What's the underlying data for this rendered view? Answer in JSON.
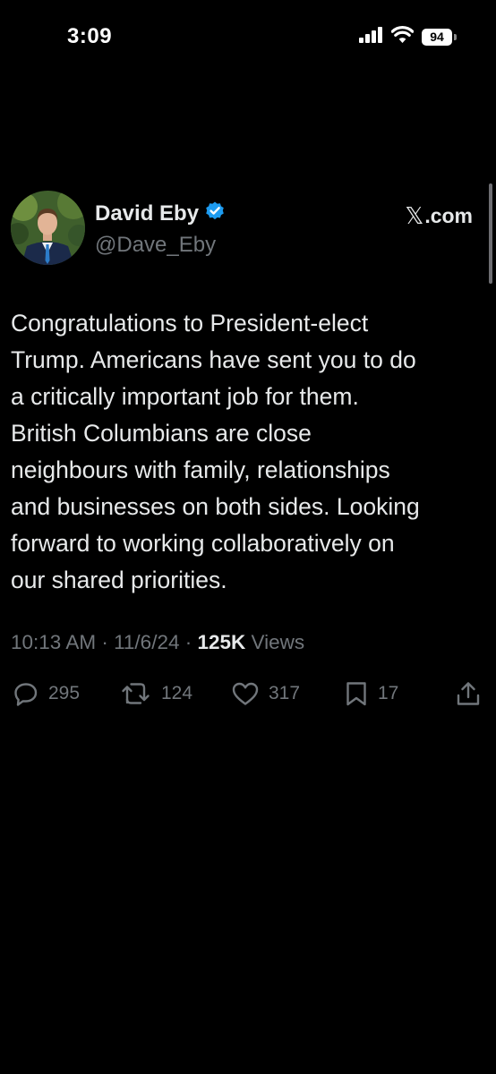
{
  "status_bar": {
    "time": "3:09",
    "battery_level": "94",
    "icons": [
      "cellular-signal-icon",
      "wifi-icon",
      "battery-icon"
    ]
  },
  "tweet": {
    "author": {
      "display_name": "David Eby",
      "handle": "@Dave_Eby",
      "verified": true
    },
    "source": {
      "glyph": "𝕏",
      "label": ".com"
    },
    "text_lines": [
      "Congratulations to President-elect",
      "Trump. Americans have sent you to do",
      "a critically important job for them.",
      "British Columbians are close",
      "neighbours with family, relationships",
      "and businesses on both sides. Looking",
      "forward to working collaboratively on",
      "our shared priorities."
    ],
    "meta": {
      "time": "10:13 AM",
      "sep1": " · ",
      "date": "11/6/24",
      "sep2": " · ",
      "views_count": "125K",
      "views_label": " Views"
    },
    "actions": {
      "replies": "295",
      "reposts": "124",
      "likes": "317",
      "bookmarks": "17"
    }
  },
  "colors": {
    "background": "#000000",
    "primary_text": "#e7e9ea",
    "secondary_text": "#71767b",
    "verified_badge": "#1d9bf0"
  }
}
